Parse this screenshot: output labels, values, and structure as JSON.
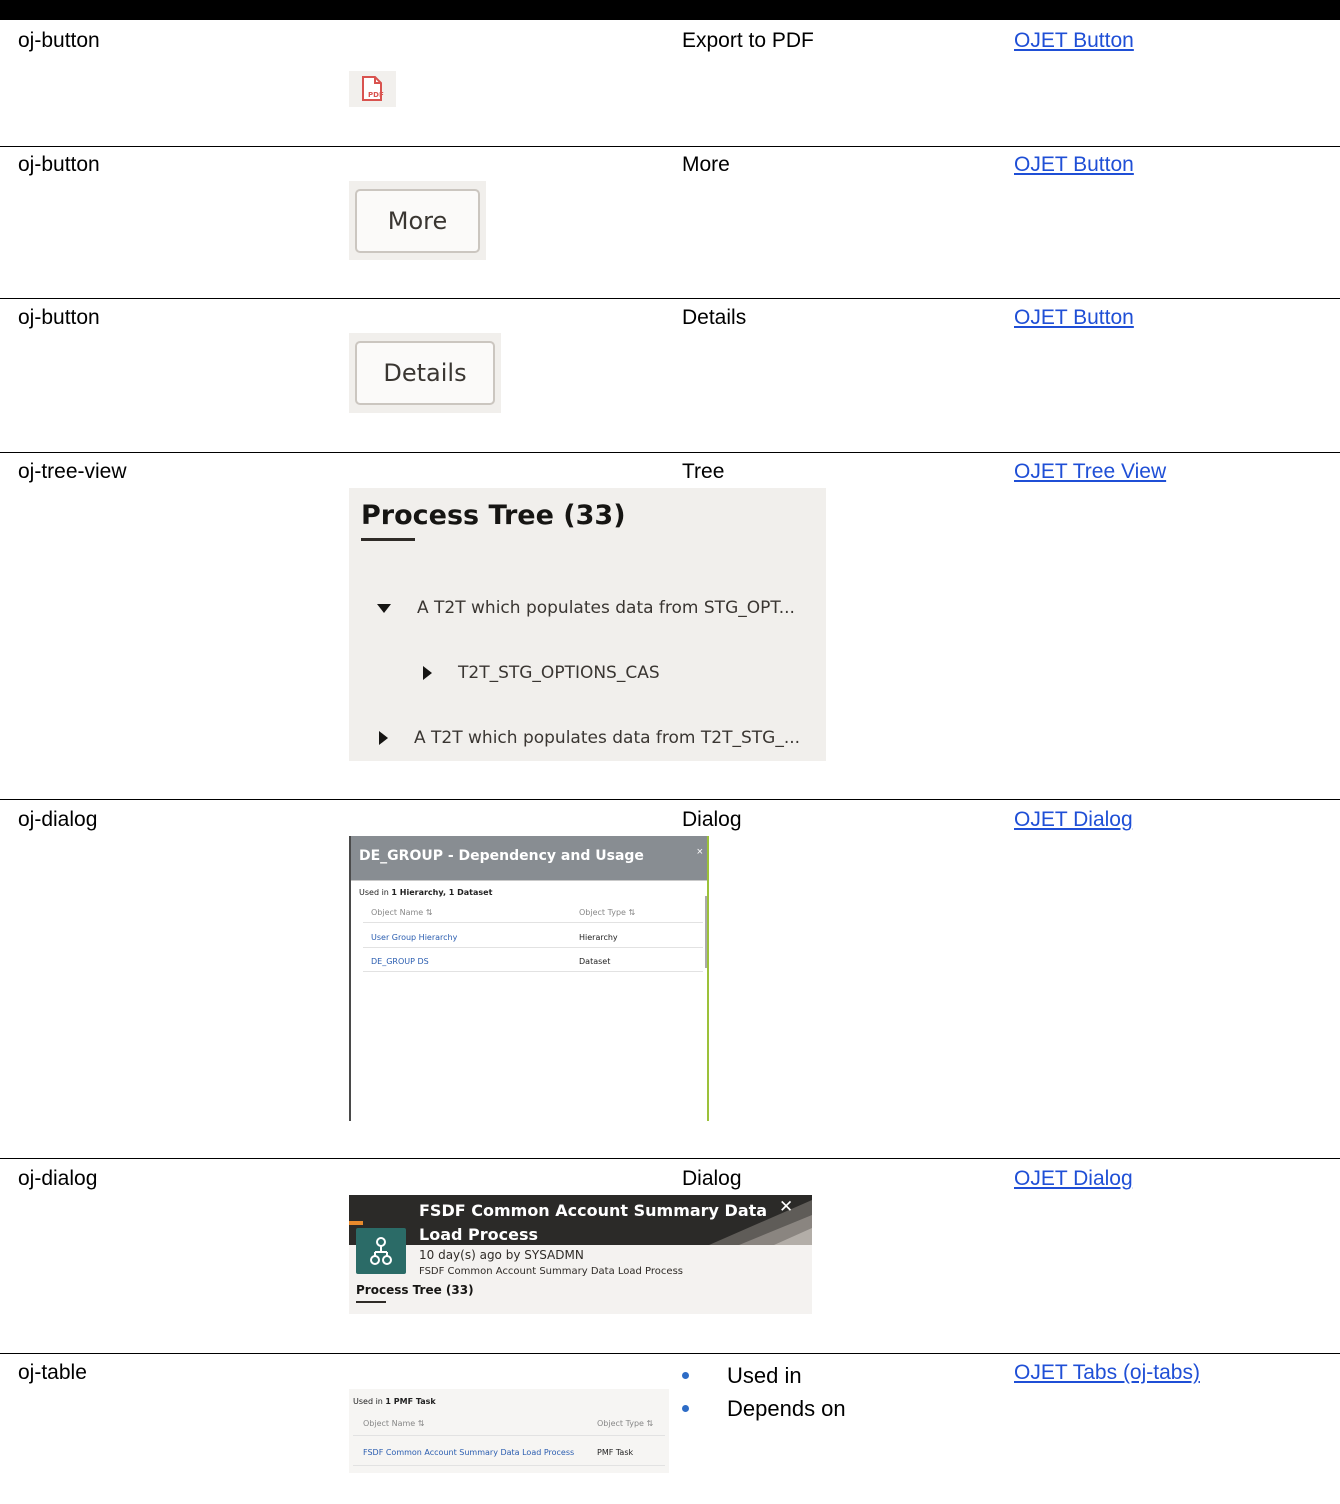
{
  "rows": [
    {
      "component": "oj-button",
      "description": "Export to PDF",
      "link": "OJET Button",
      "icon": "pdf-icon",
      "icon_label": "PDF"
    },
    {
      "component": "oj-button",
      "description": "More",
      "link": "OJET Button",
      "button_label": "More"
    },
    {
      "component": "oj-button",
      "description": "Details",
      "link": "OJET Button",
      "button_label": "Details"
    },
    {
      "component": "oj-tree-view",
      "description": "Tree",
      "link": "OJET Tree View",
      "tree": {
        "title": "Process Tree (33)",
        "nodes": [
          {
            "label": "A T2T which populates data from STG_OPT...",
            "expanded": true
          },
          {
            "label": "T2T_STG_OPTIONS_CAS",
            "expanded": false
          },
          {
            "label": "A T2T which populates data from T2T_STG_...",
            "expanded": false
          }
        ]
      }
    },
    {
      "component": "oj-dialog",
      "description": "Dialog",
      "link": "OJET Dialog",
      "dialog": {
        "title": "DE_GROUP - Dependency and Usage",
        "close": "×",
        "summary_prefix": "Used in ",
        "summary_bold": "1 Hierarchy, 1 Dataset",
        "col_name": "Object Name",
        "col_type": "Object Type",
        "sort_glyph": "⇅",
        "rows": [
          {
            "name": "User Group Hierarchy",
            "type": "Hierarchy"
          },
          {
            "name": "DE_GROUP DS",
            "type": "Dataset"
          }
        ]
      }
    },
    {
      "component": "oj-dialog",
      "description": "Dialog",
      "link": "OJET Dialog",
      "dialog": {
        "title_line1": "FSDF Common Account Summary Data",
        "title_line2": "Load Process",
        "close": "✕",
        "meta": "10 day(s) ago by SYSADMN",
        "subtitle": "FSDF Common Account Summary Data Load Process",
        "tab": "Process Tree (33)"
      }
    },
    {
      "component": "oj-table",
      "link": "OJET Tabs (oj-tabs)",
      "bullets": [
        "Used in",
        "Depends on"
      ],
      "table": {
        "summary_prefix": "Used in ",
        "summary_bold": "1 PMF Task",
        "col_name": "Object Name",
        "col_type": "Object Type",
        "sort_glyph": "⇅",
        "rows": [
          {
            "name": "FSDF Common Account Summary Data Load Process",
            "type": "PMF Task"
          }
        ]
      }
    }
  ],
  "colors": {
    "link": "#1f4fd6",
    "bullet": "#2d6cc6",
    "teal": "#2b6b67",
    "orange": "#e98a2c"
  }
}
